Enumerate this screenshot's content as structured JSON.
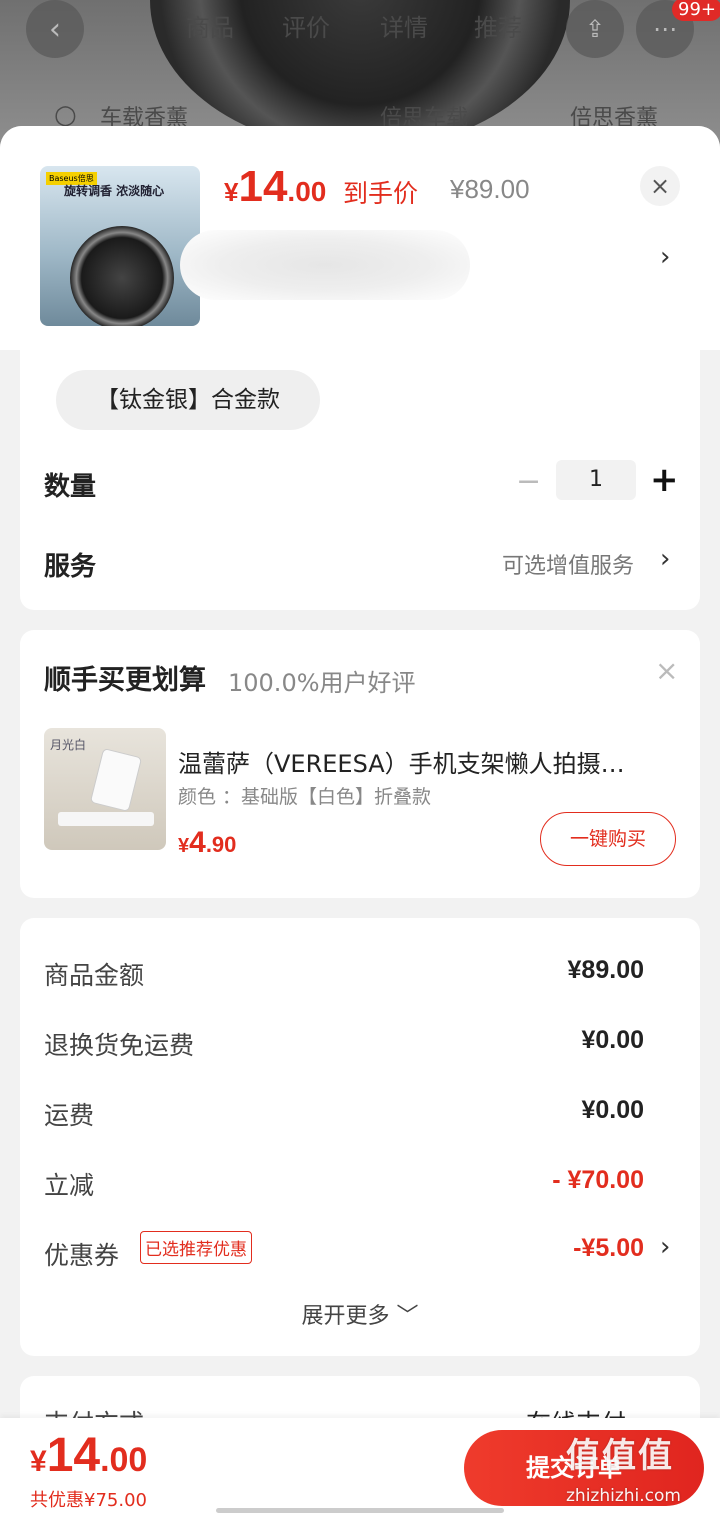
{
  "background": {
    "tabs": [
      "商品",
      "评价",
      "详情",
      "推荐"
    ],
    "badge": "99+",
    "subbar": [
      "车载香薰",
      "倍思车载",
      "倍思香薰"
    ]
  },
  "header": {
    "price_symbol": "¥",
    "price_int": "14",
    "price_dec": ".00",
    "price_tag": "到手价",
    "original_price": "¥89.00",
    "close_icon": "×",
    "chevron": "›",
    "thumb_brand": "Baseus倍思",
    "thumb_title": "旋转调香 浓淡随心"
  },
  "options": {
    "selected_variant": "【钛金银】合金款",
    "quantity_label": "数量",
    "quantity_minus": "−",
    "quantity_value": "1",
    "quantity_plus": "+",
    "service_label": "服务",
    "service_value": "可选增值服务",
    "chevron": "›"
  },
  "bundle": {
    "title": "顺手买更划算",
    "subtitle": "100.0%用户好评",
    "close_icon": "×",
    "product_name": "温蕾萨（VEREESA）手机支架懒人拍摄…",
    "product_spec": "颜色 ：基础版【白色】折叠款",
    "price_symbol": "¥",
    "price_int": "4",
    "price_dec": ".90",
    "buy_button": "一键购买",
    "img_label": "月光白"
  },
  "summary": {
    "rows": [
      {
        "label": "商品金额",
        "value": "¥89.00"
      },
      {
        "label": "退换货免运费",
        "value": "¥0.00"
      },
      {
        "label": "运费",
        "value": "¥0.00"
      },
      {
        "label": "立减",
        "value": "- ¥70.00"
      },
      {
        "label": "优惠券",
        "value": "-¥5.00"
      }
    ],
    "coupon_tag": "已选推荐优惠",
    "chevron": "›",
    "expand": "展开更多 ﹀"
  },
  "payment_peek": {
    "label": "支付方式",
    "value": "在线支付"
  },
  "footer": {
    "price_symbol": "¥",
    "price_int": "14",
    "price_dec": ".00",
    "savings": "共优惠¥75.00",
    "submit": "提交订单"
  },
  "watermark": {
    "text": "值值值",
    "site": "zhizhizhi.com"
  },
  "colors": {
    "accent": "#e22d1e",
    "background": "#f2f2f2"
  }
}
